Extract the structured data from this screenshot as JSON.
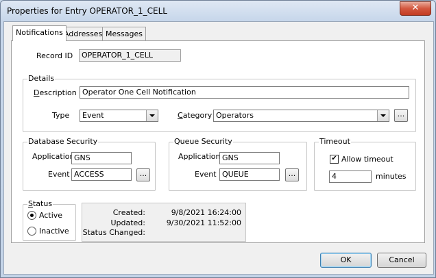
{
  "window": {
    "title": "Properties for Entry OPERATOR_1_CELL",
    "close_symbol": "✕"
  },
  "tabs": [
    {
      "label": "Notifications",
      "active": true
    },
    {
      "label": "Addresses",
      "active": false
    },
    {
      "label": "Messages",
      "active": false
    }
  ],
  "record": {
    "label": "Record ID",
    "value": "OPERATOR_1_CELL"
  },
  "details": {
    "title": "Details",
    "description_label": "Description",
    "description_value": "Operator One Cell Notification",
    "type_label": "Type",
    "type_value": "Event",
    "category_label": "Category",
    "category_value": "Operators",
    "browse": "..."
  },
  "database_security": {
    "title": "Database Security",
    "application_label": "Application",
    "application_value": "GNS",
    "event_label": "Event",
    "event_value": "ACCESS",
    "browse": "..."
  },
  "queue_security": {
    "title": "Queue Security",
    "application_label": "Application",
    "application_value": "GNS",
    "event_label": "Event",
    "event_value": "QUEUE",
    "browse": "..."
  },
  "timeout": {
    "title": "Timeout",
    "allow_label": "Allow timeout",
    "allow_checked": true,
    "check_mark": "✔",
    "value": "4",
    "unit": "minutes"
  },
  "status": {
    "title": "Status",
    "active_label": "Active",
    "inactive_label": "Inactive",
    "selected": "Active"
  },
  "info": {
    "created_label": "Created:",
    "created_value": "9/8/2021 16:24:00",
    "updated_label": "Updated:",
    "updated_value": "9/30/2021 11:52:00",
    "status_changed_label": "Status Changed:",
    "status_changed_value": ""
  },
  "buttons": {
    "ok": "OK",
    "cancel": "Cancel"
  }
}
